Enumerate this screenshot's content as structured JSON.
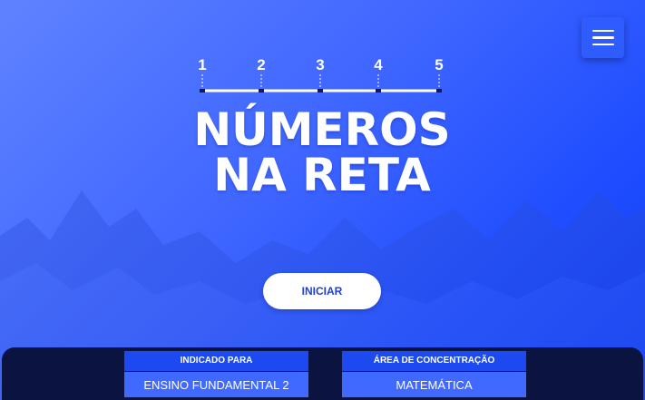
{
  "header": {
    "menu_icon": "hamburger-menu-icon"
  },
  "number_line": {
    "ticks": [
      "1",
      "2",
      "3",
      "4",
      "5"
    ]
  },
  "title": {
    "line1": "NÚMEROS",
    "line2": "NA RETA"
  },
  "start": {
    "label": "INICIAR"
  },
  "info": {
    "audience": {
      "label": "INDICADO PARA",
      "value": "ENSINO FUNDAMENTAL 2"
    },
    "area": {
      "label": "ÁREA DE CONCENTRAÇÃO",
      "value": "MATEMÁTICA"
    }
  },
  "colors": {
    "background_light": "#5f83ff",
    "background_dark": "#0f3cf5",
    "start_text": "#1f3fd6",
    "info_bar": "#0b1340",
    "info_label_bg": "#1c49f0",
    "info_value_bg": "#3f69ff"
  }
}
